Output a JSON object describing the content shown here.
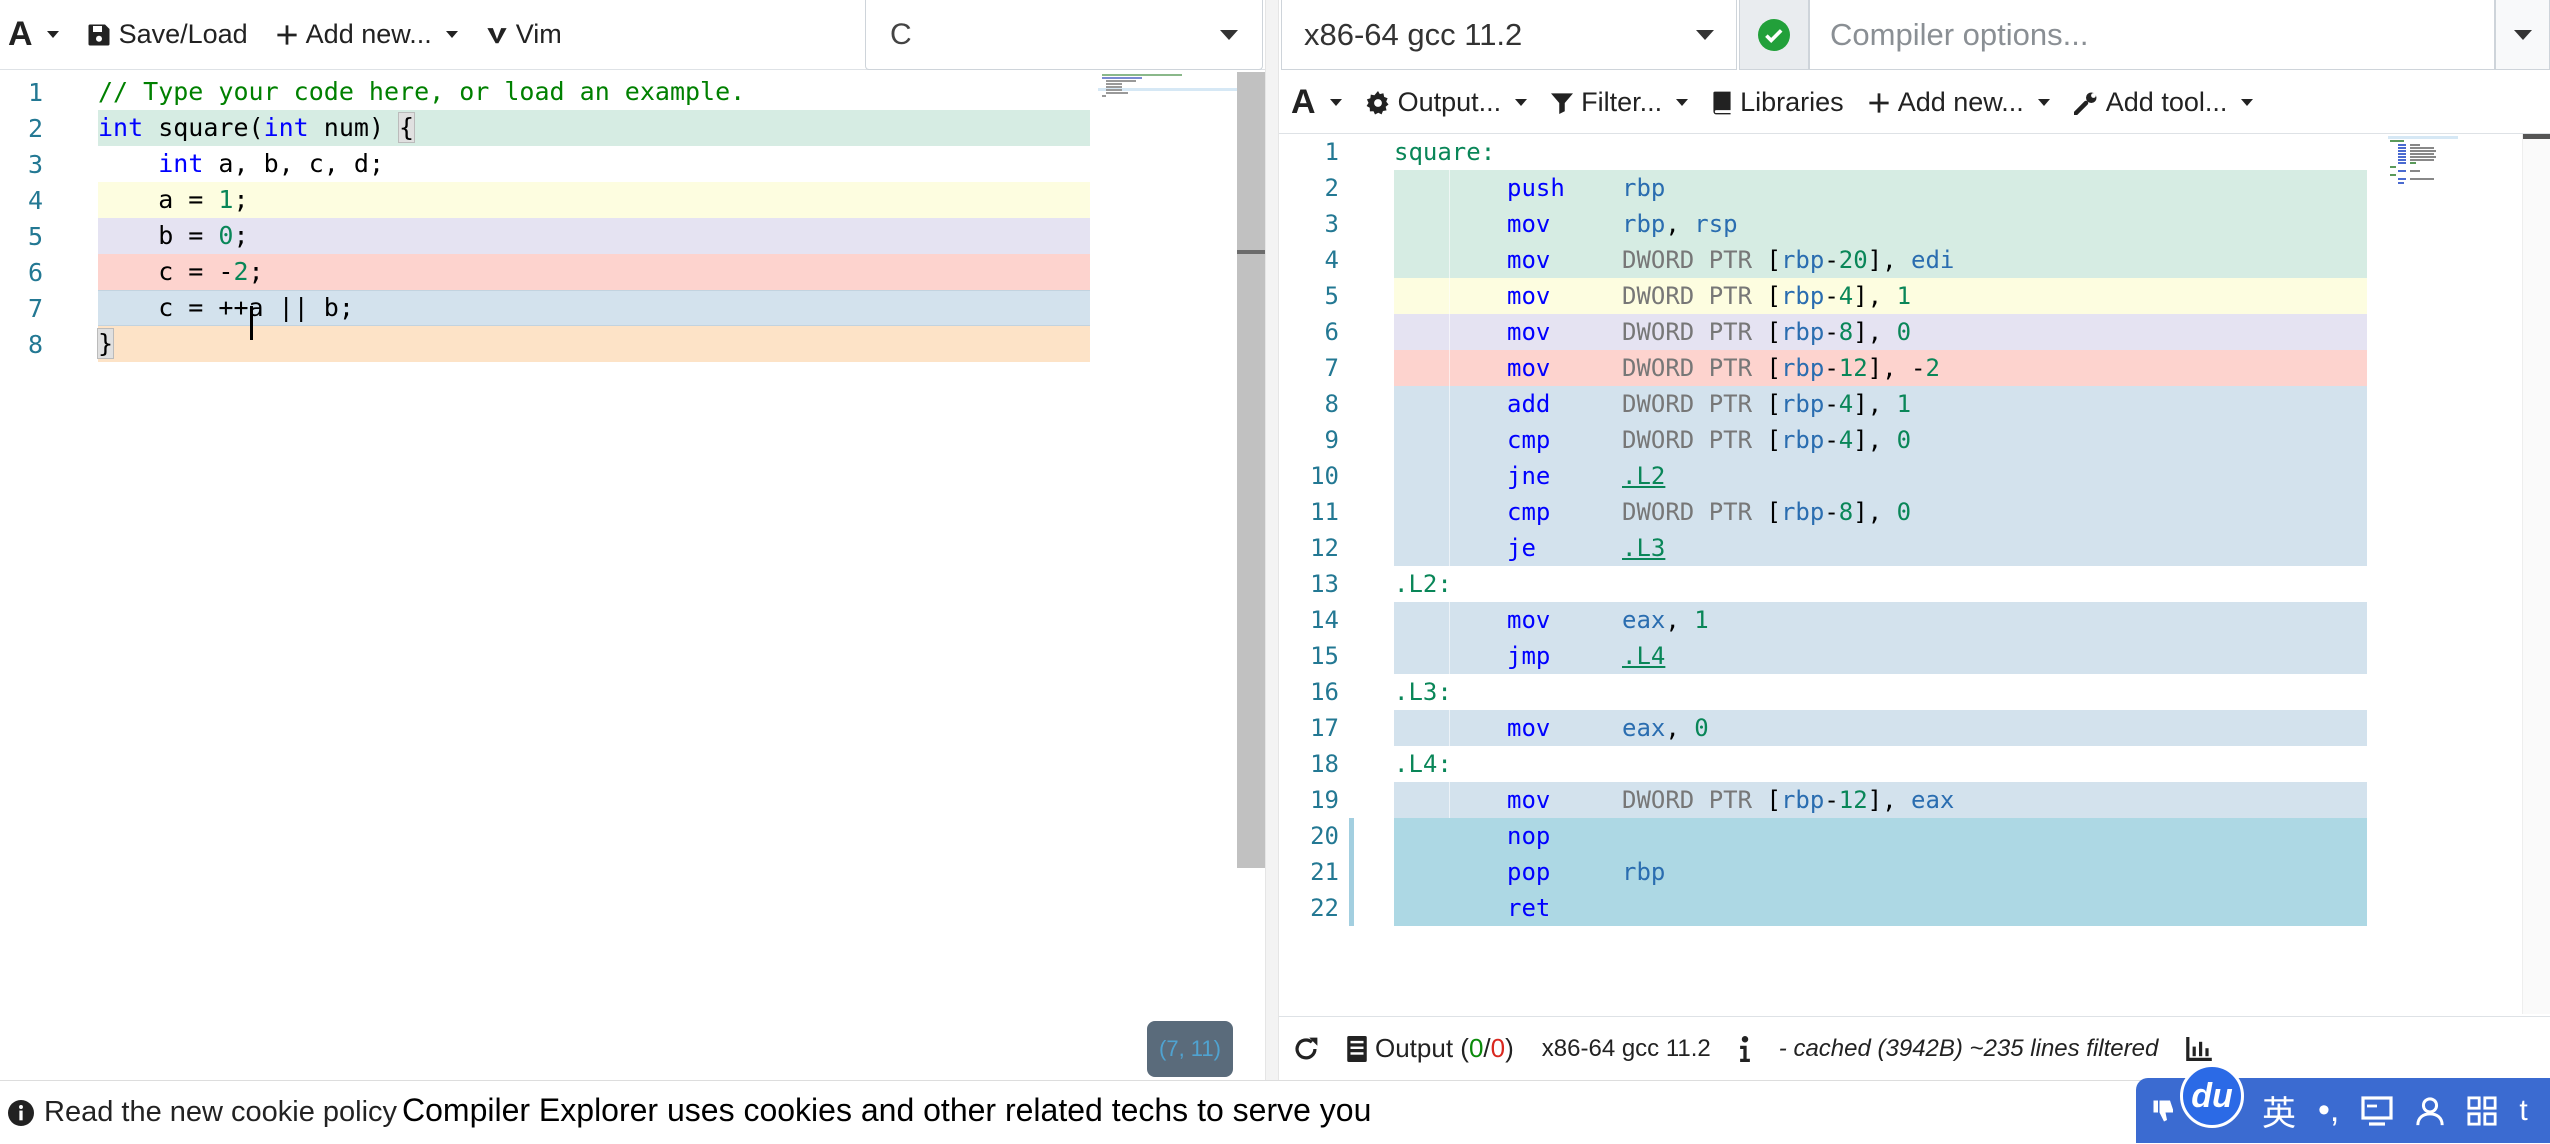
{
  "editor_toolbar": {
    "font_label": "A",
    "save_load": "Save/Load",
    "add_new": "Add new...",
    "vim": "Vim",
    "language": "C"
  },
  "source": {
    "line_numbers": [
      "1",
      "2",
      "3",
      "4",
      "5",
      "6",
      "7",
      "8"
    ],
    "cursor_position": "(7, 11)"
  },
  "compiler": {
    "name": "x86-64 gcc 11.2",
    "options_placeholder": "Compiler options..."
  },
  "output_toolbar": {
    "font_label": "A",
    "output": "Output...",
    "filter": "Filter...",
    "libraries": "Libraries",
    "add_new": "Add new...",
    "add_tool": "Add tool..."
  },
  "asm": {
    "line_numbers": [
      "1",
      "2",
      "3",
      "4",
      "5",
      "6",
      "7",
      "8",
      "9",
      "10",
      "11",
      "12",
      "13",
      "14",
      "15",
      "16",
      "17",
      "18",
      "19",
      "20",
      "21",
      "22"
    ]
  },
  "footer": {
    "output_label": "Output (",
    "output_ok": "0",
    "output_sep": "/",
    "output_err": "0",
    "output_close": ")",
    "compiler": "x86-64 gcc 11.2",
    "cache_info": "- cached (3942B) ~235 lines filtered"
  },
  "cookie": {
    "link": "Read the new cookie policy",
    "message": "Compiler Explorer uses cookies and other related techs to serve you"
  },
  "ime": {
    "logo": "du",
    "lang": "英",
    "punct": "•,",
    "tail": "t"
  },
  "colors": {
    "line2": "#d6ece3",
    "line4": "#fdfde0",
    "line5": "#e5e3f2",
    "line6": "#fdd3ce",
    "line7": "#d3e2ed",
    "line8": "#fde3c7",
    "asm_ret_block": "#add8e4"
  }
}
